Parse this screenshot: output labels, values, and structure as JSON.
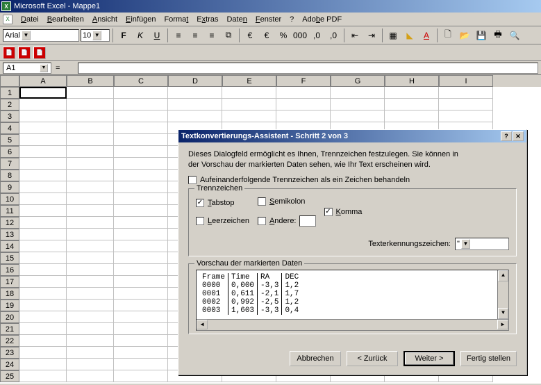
{
  "app": {
    "title": "Microsoft Excel - Mappe1"
  },
  "menu": {
    "datei": "Datei",
    "bearbeiten": "Bearbeiten",
    "ansicht": "Ansicht",
    "einfuegen": "Einfügen",
    "format": "Format",
    "extras": "Extras",
    "daten": "Daten",
    "fenster": "Fenster",
    "hilfe": "?",
    "adobe": "Adobe PDF"
  },
  "format_toolbar": {
    "font": "Arial",
    "size": "10"
  },
  "name_box": "A1",
  "formula_eq": "=",
  "columns": [
    "A",
    "B",
    "C",
    "D",
    "E",
    "F",
    "G",
    "H",
    "I"
  ],
  "dialog": {
    "title": "Textkonvertierungs-Assistent - Schritt 2 von 3",
    "desc1": "Dieses Dialogfeld ermöglicht es Ihnen, Trennzeichen festzulegen. Sie können in",
    "desc2": "der Vorschau der markierten Daten sehen, wie Ihr Text erscheinen wird.",
    "treat_consecutive": "Aufeinanderfolgende Trennzeichen als ein Zeichen behandeln",
    "trennzeichen_legend": "Trennzeichen",
    "tabstop": "Tabstop",
    "leerzeichen": "Leerzeichen",
    "semikolon": "Semikolon",
    "andere": "Andere:",
    "komma": "Komma",
    "textqual_label": "Texterkennungszeichen:",
    "textqual_value": "\"",
    "preview_legend": "Vorschau der markierten Daten",
    "preview_headers": [
      "Frame",
      "Time",
      "RA",
      "DEC"
    ],
    "preview_rows": [
      [
        "0000",
        "0,000",
        "-3,3",
        "1,2"
      ],
      [
        "0001",
        "0,611",
        "-2,1",
        "1,7"
      ],
      [
        "0002",
        "0,992",
        "-2,5",
        "1,2"
      ],
      [
        "0003",
        "1,603",
        "-3,3",
        "0,4"
      ]
    ],
    "buttons": {
      "cancel": "Abbrechen",
      "back": "< Zurück",
      "next": "Weiter >",
      "finish": "Fertig stellen"
    }
  },
  "chart_data": {
    "type": "table",
    "columns": [
      "Frame",
      "Time",
      "RA",
      "DEC"
    ],
    "rows": [
      [
        "0000",
        "0,000",
        "-3,3",
        "1,2"
      ],
      [
        "0001",
        "0,611",
        "-2,1",
        "1,7"
      ],
      [
        "0002",
        "0,992",
        "-2,5",
        "1,2"
      ],
      [
        "0003",
        "1,603",
        "-3,3",
        "0,4"
      ]
    ]
  }
}
